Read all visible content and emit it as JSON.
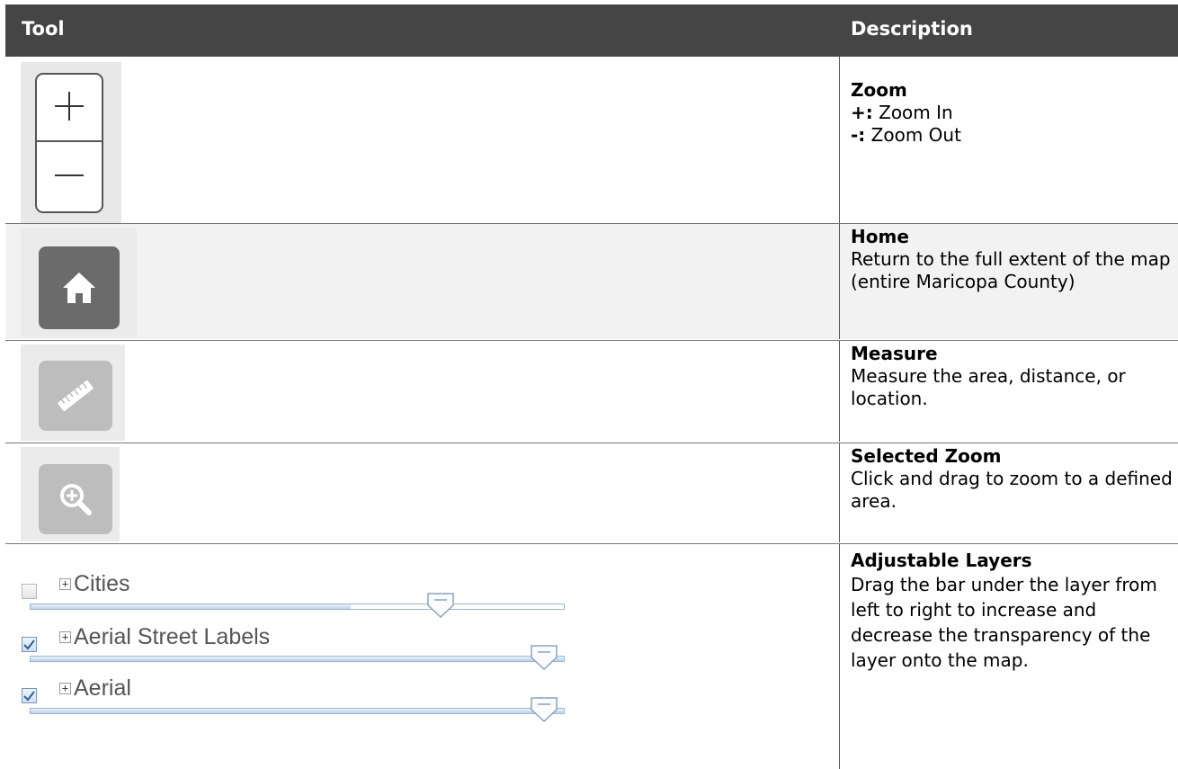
{
  "header": {
    "tool": "Tool",
    "description": "Description"
  },
  "rows": [
    {
      "title": "Zoom",
      "lines": [
        {
          "key": "+:",
          "text": " Zoom In"
        },
        {
          "key": "-:",
          "text": " Zoom Out"
        }
      ]
    },
    {
      "title": "Home",
      "text": "Return to the full extent of the map (entire Maricopa County)"
    },
    {
      "title": "Measure",
      "text": "Measure the area, distance, or location."
    },
    {
      "title": "Selected Zoom",
      "text": "Click and drag to zoom to a defined area."
    },
    {
      "title": "Adjustable Layers",
      "text": "Drag the bar under the layer from left to right to increase and decrease the transparency of the layer onto the map."
    }
  ],
  "layers": [
    {
      "label": "Cities",
      "checked": false,
      "expander": "+",
      "opacity": 0.6
    },
    {
      "label": "Aerial Street Labels",
      "checked": true,
      "expander": "+",
      "opacity": 1.0
    },
    {
      "label": "Aerial",
      "checked": true,
      "expander": "+",
      "opacity": 1.0
    }
  ],
  "colors": {
    "header_bg": "#454545",
    "button_dark": "#6b6b6b",
    "button_light": "#bdbdbd",
    "slider_accent": "#bcd3ea"
  }
}
